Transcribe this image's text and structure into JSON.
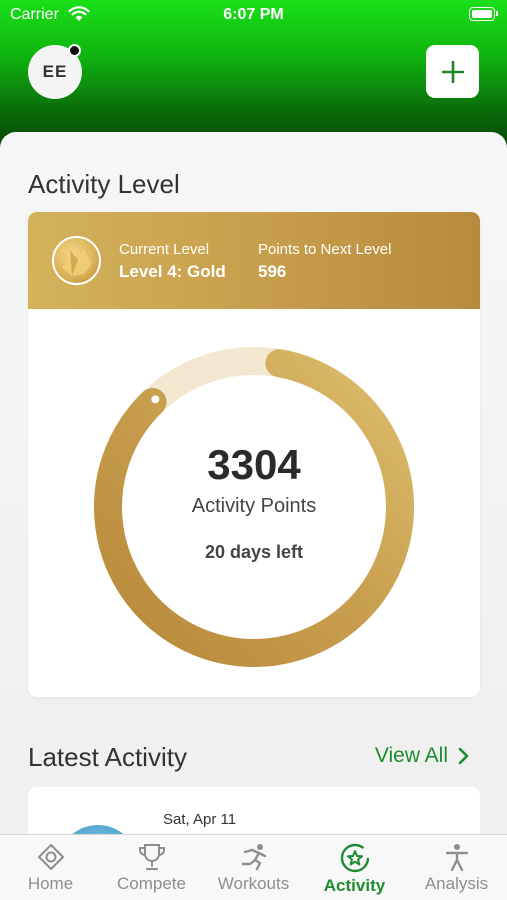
{
  "status_bar": {
    "carrier": "Carrier",
    "time": "6:07 PM"
  },
  "header": {
    "avatar_initials": "EE",
    "add_button": "+"
  },
  "activity_level": {
    "title": "Activity Level",
    "current_level_label": "Current Level",
    "current_level_value": "Level 4: Gold",
    "next_level_label": "Points to Next Level",
    "next_level_value": "596",
    "points": "3304",
    "points_label": "Activity Points",
    "days_left": "20 days left",
    "progress_fraction": 0.85
  },
  "latest_activity": {
    "title": "Latest Activity",
    "view_all": "View All",
    "items": [
      {
        "date": "Sat, Apr 11"
      }
    ]
  },
  "tabs": [
    {
      "label": "Home",
      "icon": "home-diamond-icon",
      "active": false
    },
    {
      "label": "Compete",
      "icon": "trophy-icon",
      "active": false
    },
    {
      "label": "Workouts",
      "icon": "runner-icon",
      "active": false
    },
    {
      "label": "Activity",
      "icon": "activity-star-icon",
      "active": true
    },
    {
      "label": "Analysis",
      "icon": "person-icon",
      "active": false
    }
  ],
  "colors": {
    "accent_green": "#1e8c2e",
    "gold_light": "#d4b25b",
    "gold_dark": "#b88a3d",
    "ring_track": "#f3e8cf"
  }
}
